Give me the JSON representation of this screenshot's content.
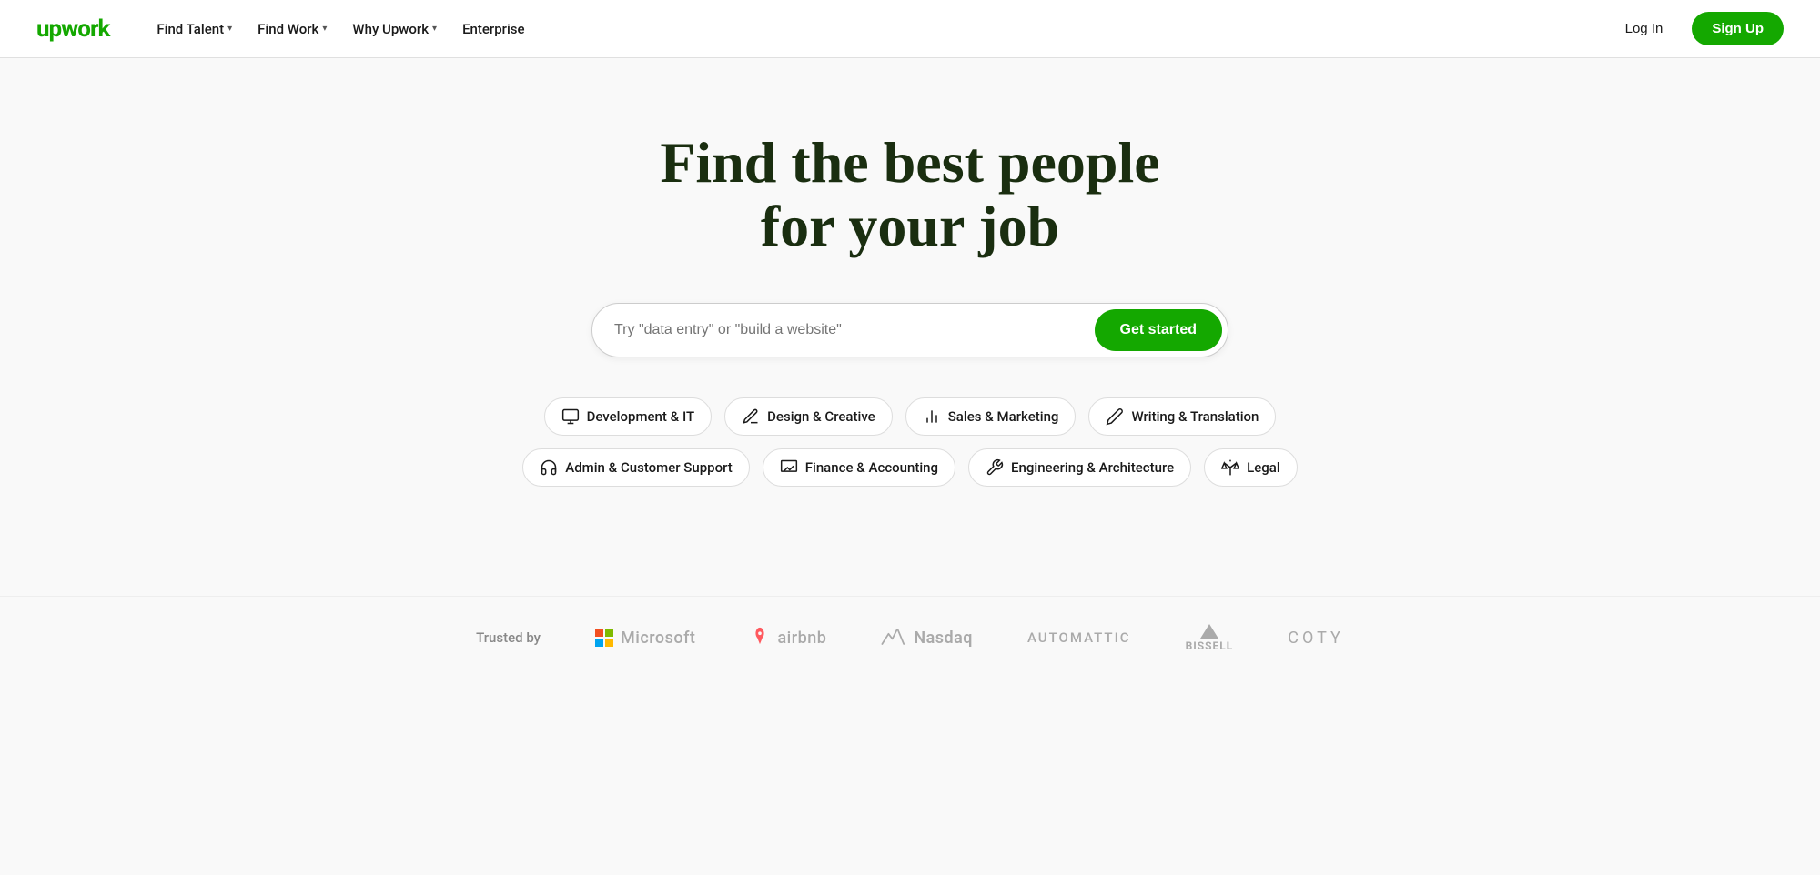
{
  "header": {
    "logo": "upwork",
    "nav": [
      {
        "label": "Find Talent",
        "hasDropdown": true
      },
      {
        "label": "Find Work",
        "hasDropdown": true
      },
      {
        "label": "Why Upwork",
        "hasDropdown": true
      },
      {
        "label": "Enterprise",
        "hasDropdown": false
      }
    ],
    "login_label": "Log In",
    "signup_label": "Sign Up"
  },
  "hero": {
    "title_line1": "Find the best people",
    "title_line2": "for your job",
    "search_placeholder": "Try \"data entry\" or \"build a website\"",
    "cta_label": "Get started"
  },
  "categories": {
    "row1": [
      {
        "label": "Development & IT",
        "icon": "💻"
      },
      {
        "label": "Design & Creative",
        "icon": "✏️"
      },
      {
        "label": "Sales & Marketing",
        "icon": "📊"
      },
      {
        "label": "Writing & Translation",
        "icon": "🖊️"
      }
    ],
    "row2": [
      {
        "label": "Admin & Customer Support",
        "icon": "🎧"
      },
      {
        "label": "Finance & Accounting",
        "icon": "📈"
      },
      {
        "label": "Engineering & Architecture",
        "icon": "⚙️"
      },
      {
        "label": "Legal",
        "icon": "⚖️"
      }
    ]
  },
  "trusted": {
    "label": "Trusted by",
    "logos": [
      "Microsoft",
      "airbnb",
      "Nasdaq",
      "AUTOMATTIC",
      "bissell",
      "COTY"
    ]
  }
}
